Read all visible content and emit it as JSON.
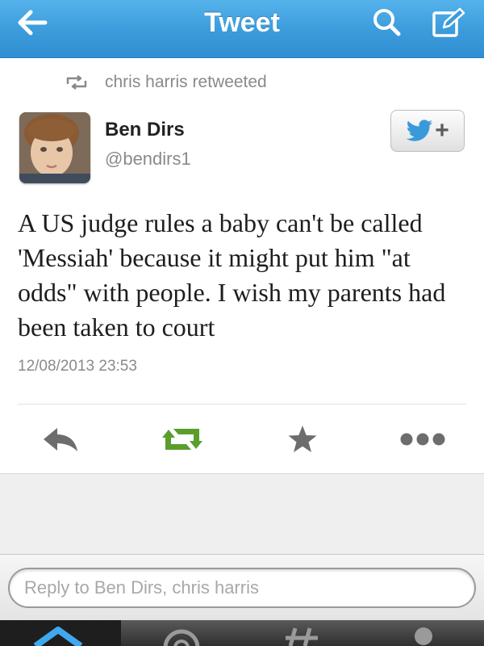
{
  "header": {
    "title": "Tweet",
    "back_icon": "back-arrow-icon",
    "search_icon": "search-icon",
    "compose_icon": "compose-icon",
    "bar_color": "#3b9bdb"
  },
  "retweet_context": {
    "text": "chris harris retweeted",
    "icon": "retweet-icon"
  },
  "author": {
    "name": "Ben Dirs",
    "handle": "@bendirs1",
    "avatar": "avatar-photo"
  },
  "follow_button": {
    "icon": "twitter-bird-icon",
    "label": "+"
  },
  "tweet": {
    "text": "A US judge rules a baby can't be called 'Messiah' because it might put him \"at odds\" with people. I wish my parents had been taken to court",
    "timestamp": "12/08/2013 23:53"
  },
  "actions": [
    {
      "name": "reply",
      "icon": "reply-icon",
      "color": "#6d6d6d"
    },
    {
      "name": "retweet",
      "icon": "retweet-icon",
      "color": "#5a9e2c"
    },
    {
      "name": "favorite",
      "icon": "star-icon",
      "color": "#6d6d6d"
    },
    {
      "name": "more",
      "icon": "more-icon",
      "color": "#6d6d6d"
    }
  ],
  "reply": {
    "placeholder": "Reply to Ben Dirs, chris harris",
    "value": ""
  },
  "tabs": [
    {
      "name": "home",
      "icon": "home-icon",
      "active": true
    },
    {
      "name": "connect",
      "icon": "at-icon",
      "active": false
    },
    {
      "name": "discover",
      "icon": "hash-icon",
      "active": false
    },
    {
      "name": "me",
      "icon": "person-icon",
      "active": false
    }
  ]
}
